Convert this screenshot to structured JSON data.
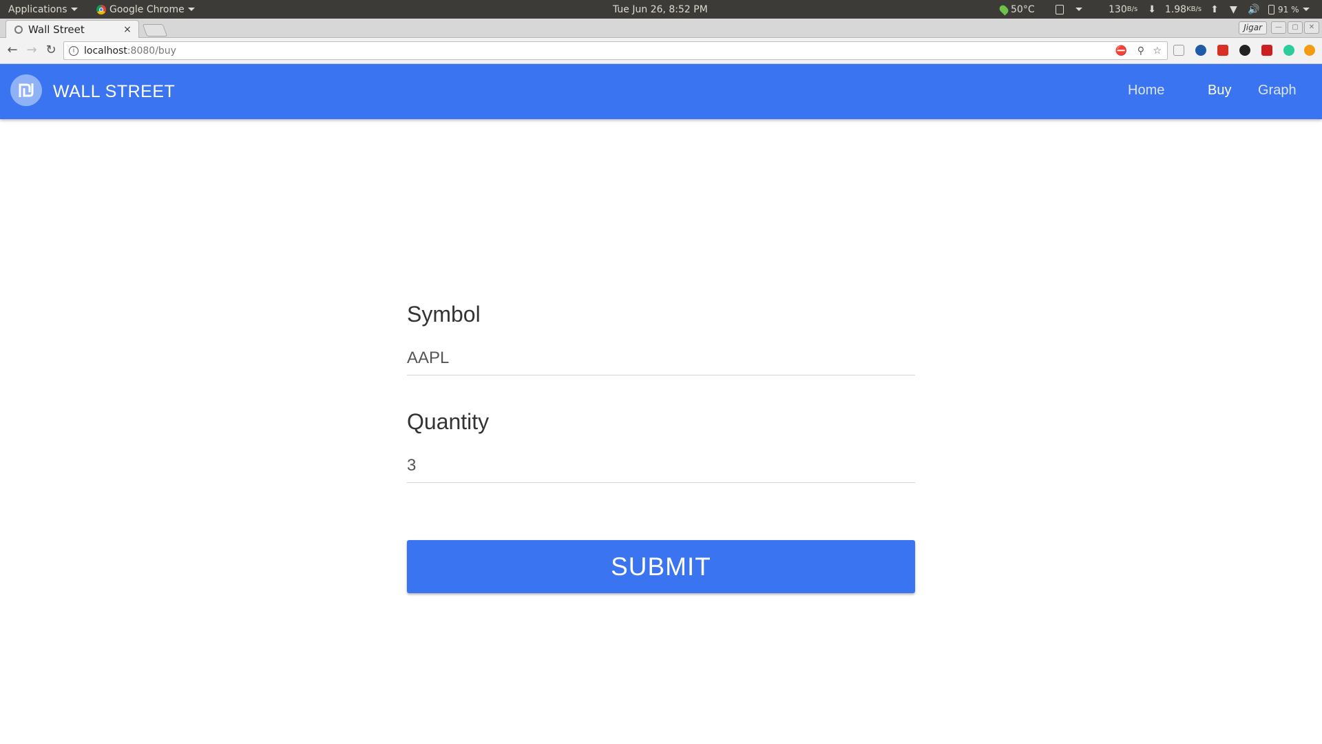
{
  "os_panel": {
    "applications": "Applications",
    "browser_app": "Google Chrome",
    "datetime": "Tue Jun 26,  8:52 PM",
    "temperature": "50°C",
    "net_down": "130",
    "net_down_unit": "B/s",
    "net_up": "1.98",
    "net_up_unit": "KB/s",
    "battery": "91 %"
  },
  "browser": {
    "tab_title": "Wall Street",
    "tab_close": "×",
    "user": "Jigar",
    "url_host": "localhost",
    "url_path": ":8080/buy"
  },
  "app": {
    "title": "WALL STREET",
    "logo_glyph": "₪",
    "nav": [
      {
        "label": "Home"
      },
      {
        "label": "Buy"
      },
      {
        "label": "Graph"
      }
    ],
    "accent_color": "#3b74f0"
  },
  "form": {
    "symbol_label": "Symbol",
    "symbol_value": "AAPL",
    "quantity_label": "Quantity",
    "quantity_value": "3",
    "submit_label": "SUBMIT"
  },
  "icons": [
    "chevron-down-icon",
    "chrome-icon",
    "temperature-icon",
    "clipboard-icon",
    "arrow-down-icon",
    "arrow-up-icon",
    "wifi-icon",
    "volume-icon",
    "battery-icon",
    "back-icon",
    "forward-icon",
    "reload-icon",
    "info-icon",
    "zoom-icon",
    "star-icon",
    "logo-icon"
  ]
}
